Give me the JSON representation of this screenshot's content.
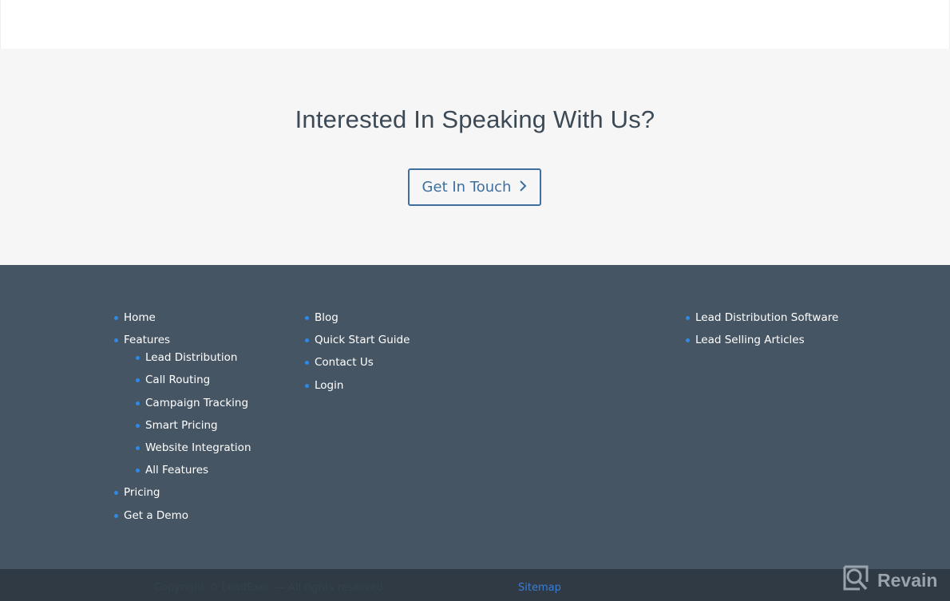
{
  "cta": {
    "heading": "Interested In Speaking With Us?",
    "button_label": "Get In Touch",
    "button_icon": "chevron-right-icon"
  },
  "footer": {
    "column1": {
      "items": [
        {
          "label": "Home"
        },
        {
          "label": "Features",
          "children": [
            {
              "label": "Lead Distribution"
            },
            {
              "label": "Call Routing"
            },
            {
              "label": "Campaign Tracking"
            },
            {
              "label": "Smart Pricing"
            },
            {
              "label": "Website Integration"
            },
            {
              "label": "All Features"
            }
          ]
        },
        {
          "label": "Pricing"
        },
        {
          "label": "Get a Demo"
        }
      ]
    },
    "column2": {
      "items": [
        {
          "label": "Blog"
        },
        {
          "label": "Quick Start Guide"
        },
        {
          "label": "Contact Us"
        },
        {
          "label": "Login"
        }
      ]
    },
    "column3": {
      "items": [
        {
          "label": "Lead Distribution Software"
        },
        {
          "label": "Lead Selling Articles"
        }
      ]
    },
    "accent_color": "#2e8ae6",
    "background_color": "#465563"
  },
  "bottom_bar": {
    "copyright": "Copyright © LeadExec — All rights reserved",
    "sitemap_label": "Sitemap"
  },
  "watermark": {
    "label": "Revain",
    "icon": "revain-logo-icon"
  }
}
